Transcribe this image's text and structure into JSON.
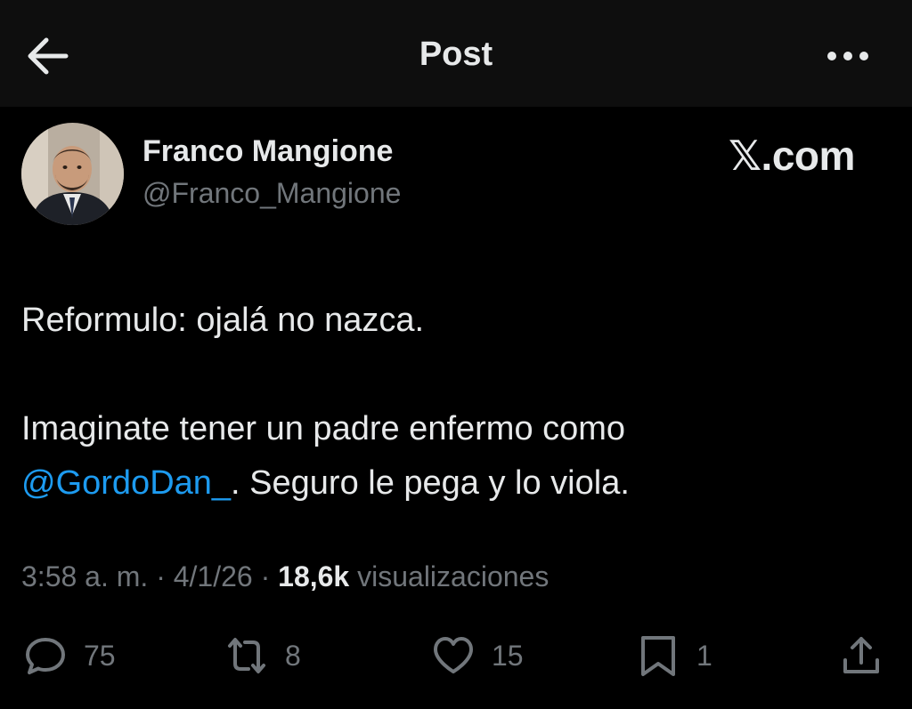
{
  "header": {
    "title": "Post",
    "back_icon": "arrow-left-icon",
    "more_icon": "more-horizontal-icon"
  },
  "author": {
    "name": "Franco Mangione",
    "handle": "@Franco_Mangione"
  },
  "watermark": "𝕏.com",
  "tweet": {
    "line1": "Reformulo: ojalá no nazca.",
    "line2": "Imaginate tener un padre enfermo como",
    "mention": "@GordoDan_",
    "line3_rest": ". Seguro le pega y lo viola."
  },
  "meta": {
    "time": "3:58 a. m.",
    "separator": " · ",
    "date": "4/1/26",
    "views_count": "18,6k",
    "views_label": " visualizaciones"
  },
  "actions": {
    "replies": "75",
    "reposts": "8",
    "likes": "15",
    "bookmarks": "1"
  },
  "colors": {
    "accent": "#1d9bf0",
    "secondary_text": "#71767b",
    "background": "#000000"
  }
}
